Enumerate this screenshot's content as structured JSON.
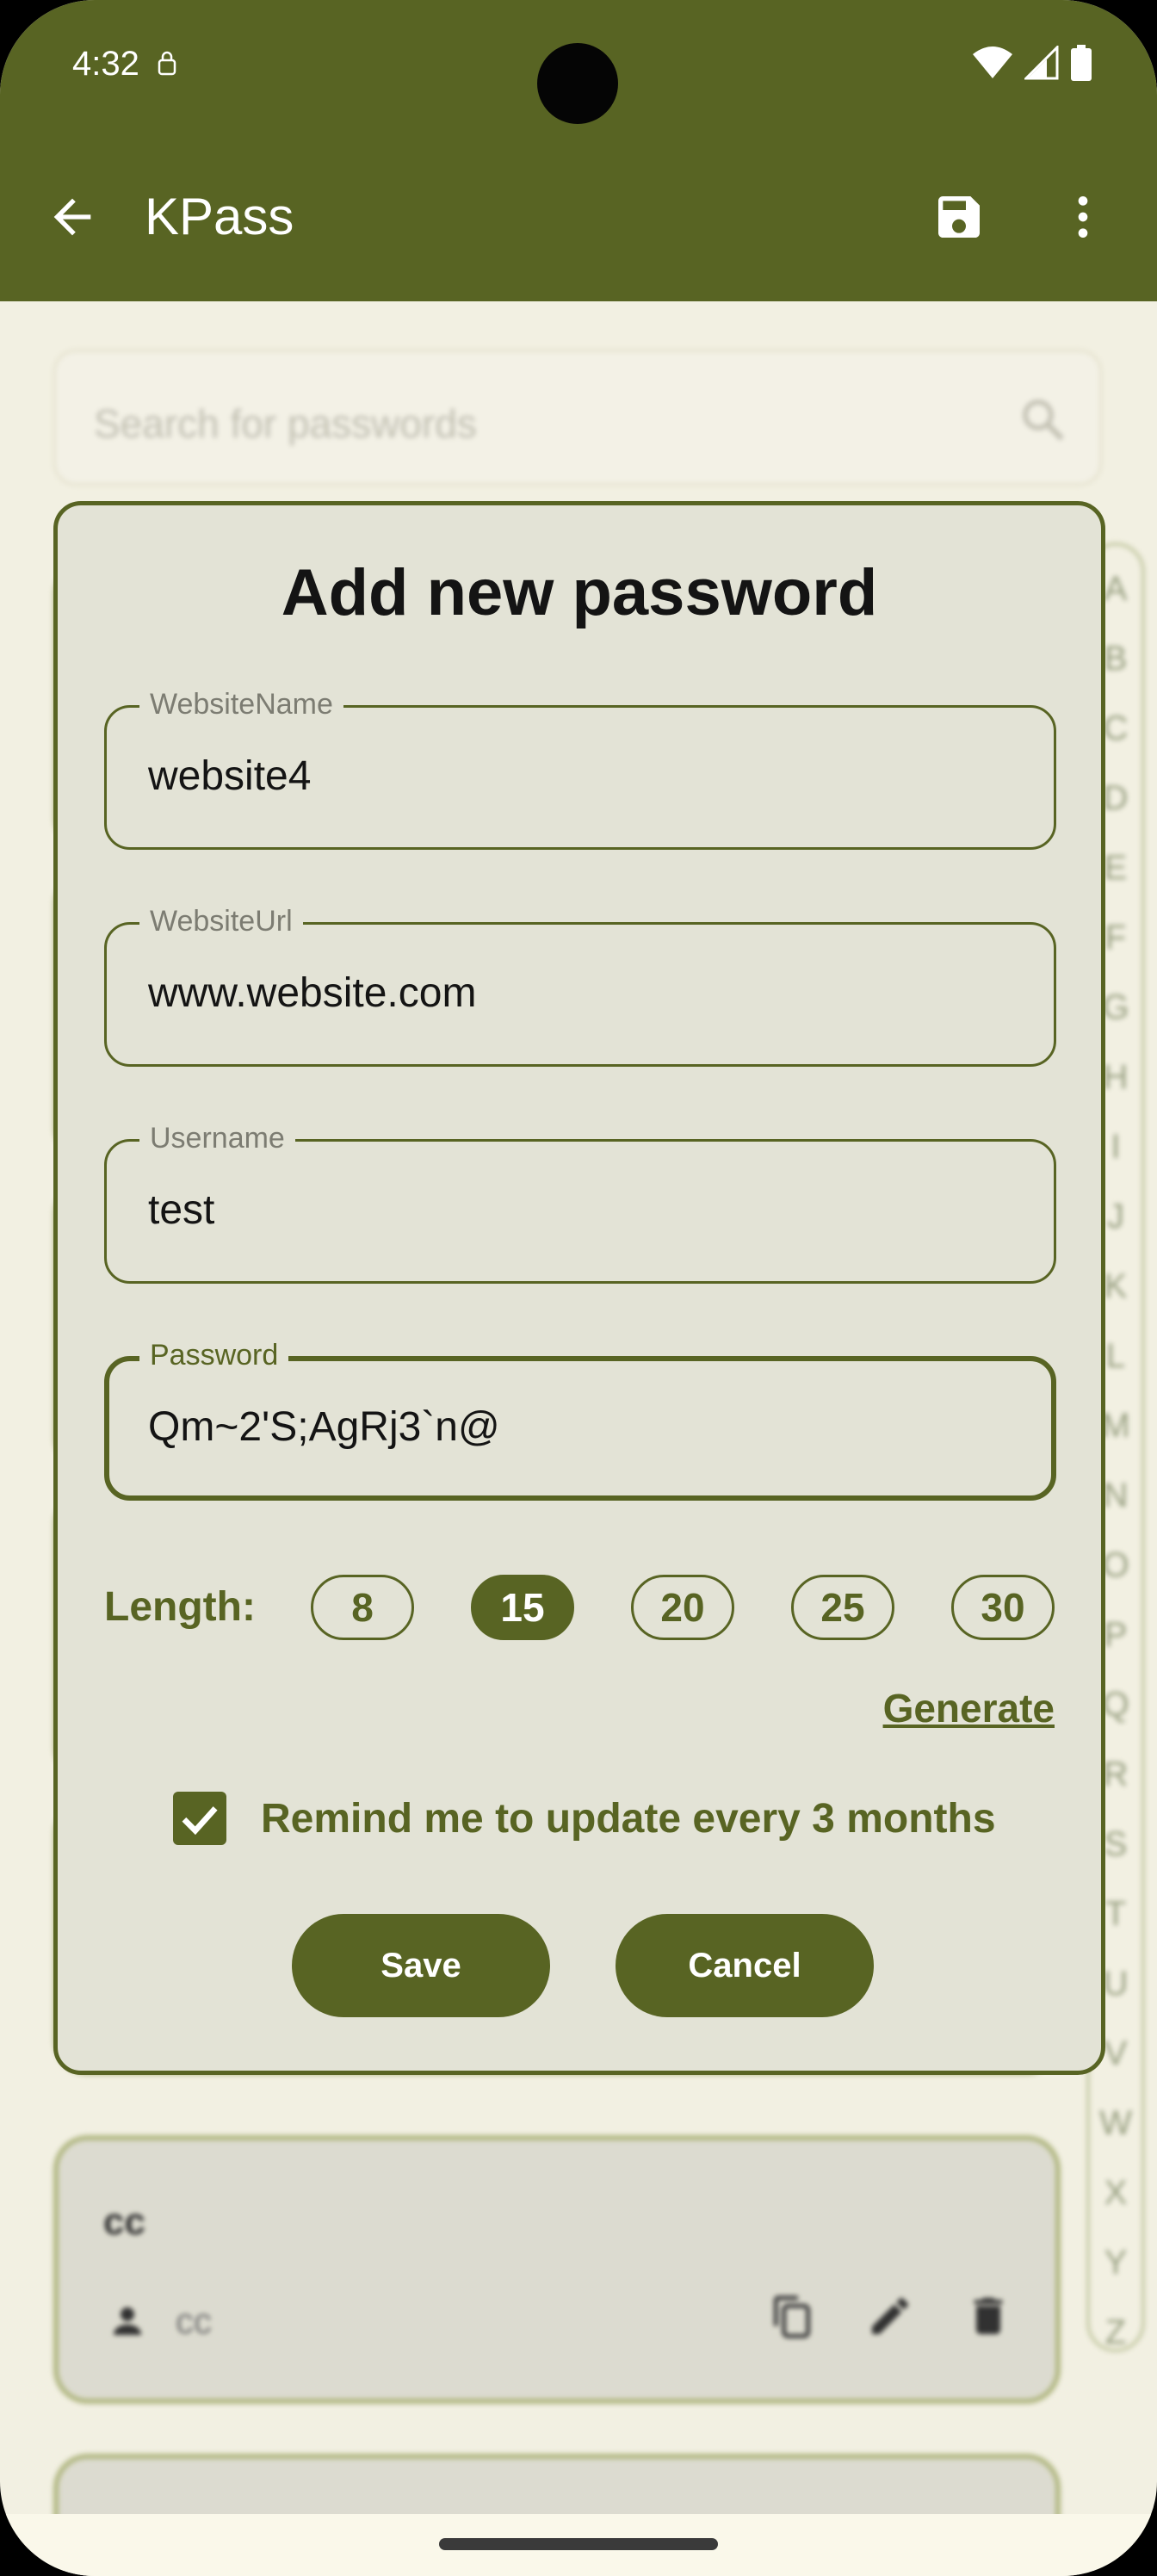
{
  "status_bar": {
    "time": "4:32"
  },
  "app_bar": {
    "title": "KPass"
  },
  "search": {
    "placeholder": "Search for passwords"
  },
  "alphabet": [
    "A",
    "B",
    "C",
    "D",
    "E",
    "F",
    "G",
    "H",
    "I",
    "J",
    "K",
    "L",
    "M",
    "N",
    "O",
    "P",
    "Q",
    "R",
    "S",
    "T",
    "U",
    "V",
    "W",
    "X",
    "Y",
    "Z"
  ],
  "background_card": {
    "title": "cc",
    "username": "cc"
  },
  "dialog": {
    "title": "Add new password",
    "fields": {
      "website_name": {
        "label": "WebsiteName",
        "value": "website4"
      },
      "website_url": {
        "label": "WebsiteUrl",
        "value": "www.website.com"
      },
      "username": {
        "label": "Username",
        "value": "test"
      },
      "password": {
        "label": "Password",
        "value": "Qm~2'S;AgRj3`n@"
      }
    },
    "length_label": "Length:",
    "length_options": [
      "8",
      "15",
      "20",
      "25",
      "30"
    ],
    "selected_length": "15",
    "generate_label": "Generate",
    "remind_label": "Remind me to update every 3 months",
    "remind_checked": true,
    "save_label": "Save",
    "cancel_label": "Cancel"
  },
  "colors": {
    "primary": "#586423",
    "background": "#faf8ea",
    "dialog_surface": "#e3e3d6"
  }
}
